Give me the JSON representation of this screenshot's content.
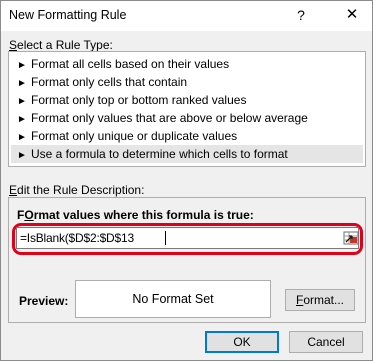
{
  "window": {
    "title": "New Formatting Rule",
    "help_label": "?",
    "close_label": "✕"
  },
  "rule_type": {
    "label_u": "S",
    "label_rest": "elect a Rule Type:",
    "items": [
      "Format all cells based on their values",
      "Format only cells that contain",
      "Format only top or bottom ranked values",
      "Format only values that are above or below average",
      "Format only unique or duplicate values",
      "Use a formula to determine which cells to format"
    ],
    "selected_index": 5,
    "arrow_glyph": "►"
  },
  "rule_description": {
    "label_u": "E",
    "label_rest": "dit the Rule Description:",
    "formula_label_u": "O",
    "formula_label_pre": "F",
    "formula_label_rest": "rmat values where this formula is true:",
    "formula_value": "=IsBlank($D$2:$D$13",
    "collapse_icon": "range-selector-icon"
  },
  "preview": {
    "label": "Preview:",
    "text": "No Format Set",
    "format_button_u": "F",
    "format_button_rest": "ormat..."
  },
  "footer": {
    "ok_label": "OK",
    "cancel_label": "Cancel"
  },
  "colors": {
    "highlight_ring": "#e0001a",
    "default_button_border": "#0078d7",
    "selected_item_bg": "#e5e5e5"
  }
}
